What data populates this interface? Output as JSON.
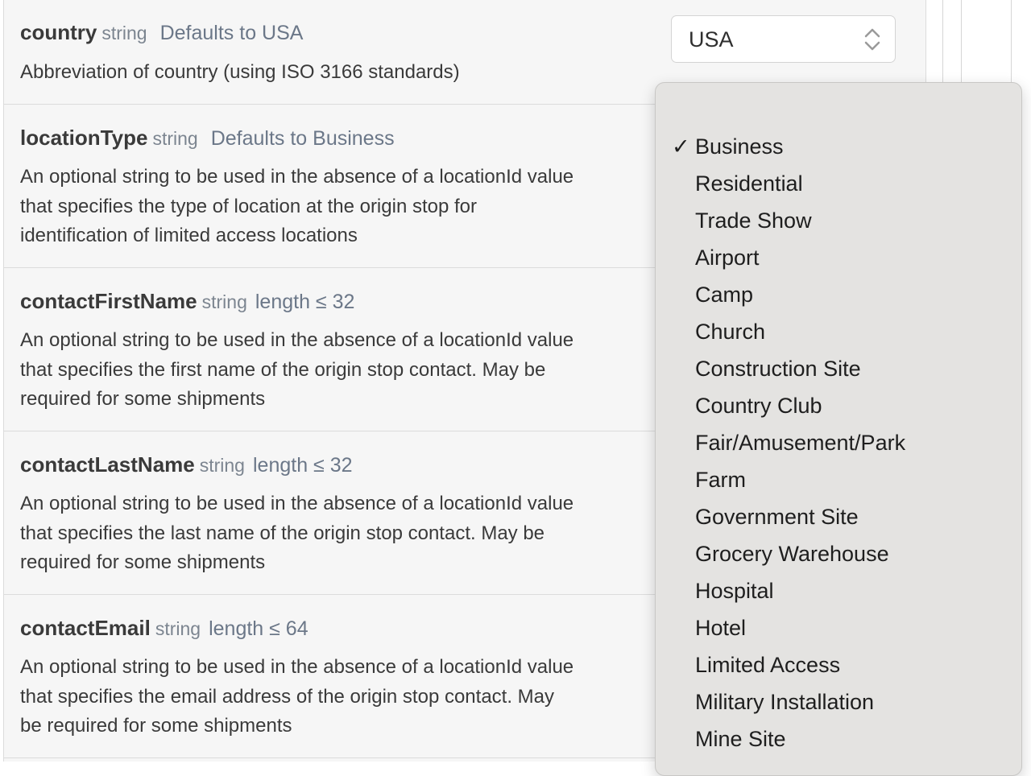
{
  "params": [
    {
      "name": "country",
      "type": "string",
      "meta": "Defaults to USA",
      "description": "Abbreviation of country (using ISO 3166 standards)"
    },
    {
      "name": "locationType",
      "type": "string",
      "meta": "Defaults to Business",
      "description_lines": [
        "An optional string to be used in the absence of a locationId value",
        "that specifies the type of location at the origin stop for",
        "identification of limited access locations"
      ]
    },
    {
      "name": "contactFirstName",
      "type": "string",
      "meta": "length ≤ 32",
      "description_lines": [
        "An optional string to be used in the absence of a locationId value",
        "that specifies the first name of the origin stop contact. May be",
        "required for some shipments"
      ]
    },
    {
      "name": "contactLastName",
      "type": "string",
      "meta": "length ≤ 32",
      "description_lines": [
        "An optional string to be used in the absence of a locationId value",
        "that specifies the last name of the origin stop contact. May be",
        "required for some shipments"
      ]
    },
    {
      "name": "contactEmail",
      "type": "string",
      "meta": "length ≤ 64",
      "description_lines": [
        "An optional string to be used in the absence of a locationId value",
        "that specifies the email address of the origin stop contact. May",
        "be required for some shipments"
      ]
    }
  ],
  "country_select": {
    "value": "USA",
    "icon": "up-down-chevron-icon"
  },
  "location_type_dropdown": {
    "check_mark": "✓",
    "options": [
      "Business",
      "Residential",
      "Trade Show",
      "Airport",
      "Camp",
      "Church",
      "Construction Site",
      "Country Club",
      "Fair/Amusement/Park",
      "Farm",
      "Government Site",
      "Grocery Warehouse",
      "Hospital",
      "Hotel",
      "Limited Access",
      "Military Installation",
      "Mine Site"
    ],
    "selected": "Business"
  }
}
